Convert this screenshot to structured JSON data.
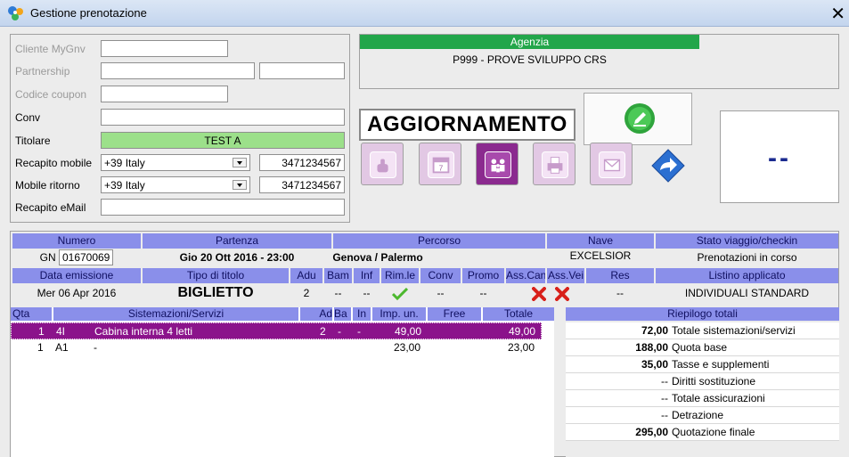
{
  "window": {
    "title": "Gestione prenotazione",
    "close_glyph": "✕"
  },
  "form": {
    "cliente_label": "Cliente MyGnv",
    "partnership_label": "Partnership",
    "coupon_label": "Codice coupon",
    "conv_label": "Conv",
    "titolare_label": "Titolare",
    "titolare_value": "TEST A",
    "recapito_mobile_label": "Recapito mobile",
    "recapito_mobile_prefix": "+39 Italy",
    "recapito_mobile_number": "3471234567",
    "mobile_ritorno_label": "Mobile ritorno",
    "mobile_ritorno_prefix": "+39 Italy",
    "mobile_ritorno_number": "3471234567",
    "recapito_email_label": "Recapito eMail"
  },
  "agenzia": {
    "header": "Agenzia",
    "value": "P999 - PROVE SVILUPPO CRS"
  },
  "status_banner": "AGGIORNAMENTO",
  "dash_text": "--",
  "trip": {
    "headers": [
      "Numero",
      "Partenza",
      "Percorso",
      "Nave",
      "Stato viaggio/checkin"
    ],
    "gn_label": "GN",
    "numero": "01670069",
    "partenza": "Gio 20 Ott 2016 - 23:00",
    "percorso": "Genova / Palermo",
    "nave": "EXCELSIOR",
    "stato": "Prenotazioni in corso"
  },
  "ticket": {
    "headers": [
      "Data emissione",
      "Tipo di titolo",
      "Adu",
      "Bam",
      "Inf",
      "Rim.le",
      "Conv",
      "Promo",
      "Ass.Can",
      "Ass.Vei",
      "Res",
      "Listino applicato"
    ],
    "data_emissione": "Mer 06 Apr 2016",
    "tipo_titolo": "BIGLIETTO",
    "adu": "2",
    "bam": "--",
    "inf": "--",
    "conv": "--",
    "promo": "--",
    "res": "--",
    "listino": "INDIVIDUALI STANDARD"
  },
  "detail": {
    "headers": [
      "Qta",
      "Sistemazioni/Servizi",
      "Ad",
      "Ba",
      "In",
      "Imp. un.",
      "Free",
      "Totale"
    ],
    "rows": [
      {
        "qta": "1",
        "code": "4I",
        "desc": "Cabina interna 4 letti",
        "ad": "2",
        "ba": "-",
        "in": "-",
        "imp": "49,00",
        "free": "",
        "totale": "49,00"
      },
      {
        "qta": "1",
        "code": "A1",
        "desc": "-",
        "ad": "",
        "ba": "",
        "in": "",
        "imp": "23,00",
        "free": "",
        "totale": "23,00"
      }
    ]
  },
  "riepilogo": {
    "header": "Riepilogo totali",
    "rows": [
      {
        "value": "72,00",
        "label": "Totale sistemazioni/servizi"
      },
      {
        "value": "188,00",
        "label": "Quota base"
      },
      {
        "value": "35,00",
        "label": "Tasse e supplementi"
      },
      {
        "value": "--",
        "label": "Diritti sostituzione"
      },
      {
        "value": "--",
        "label": "Totale assicurazioni"
      },
      {
        "value": "--",
        "label": "Detrazione"
      },
      {
        "value": "295,00",
        "label": "Quotazione finale"
      }
    ]
  },
  "toolbar_icons": [
    "touch-icon",
    "calendar-icon",
    "passengers-icon",
    "print-icon",
    "email-icon",
    "forward-arrow-icon",
    "edit-pencil-icon"
  ],
  "colors": {
    "accent_green": "#22a64a",
    "header_blue": "#8a8fea",
    "selection_purple": "#8b138b",
    "field_green": "#9ce08a"
  }
}
